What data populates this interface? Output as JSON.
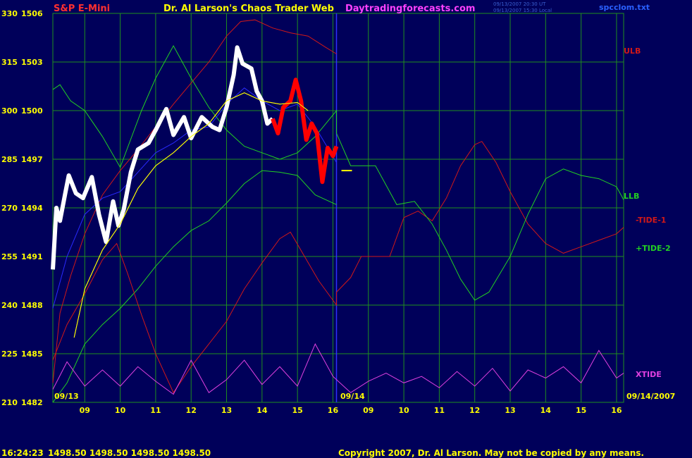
{
  "header": {
    "symbol": "S&P E-Mini",
    "title": "Dr. Al Larson's Chaos Trader Web",
    "site": "Daytradingforecasts.com",
    "timestamp1": "09/13/2007 20:30 UT",
    "timestamp2": "09/13/2007 15:30 Local",
    "file": "spcclom.txt"
  },
  "footer": {
    "time": "16:24:23",
    "quote": "1498.50 1498.50 1498.50 1498.50",
    "copyright": "Copyright 2007, Dr. Al Larson. May not be copied by any means."
  },
  "colors": {
    "background": "#00005a",
    "grid": "#1f8f1f",
    "tick_labels": "#ffff00",
    "price": "#ffffff",
    "price_recent": "#ff0000",
    "ulb": "#d01818",
    "llb": "#22d022",
    "tide1": "#d01818",
    "tide2": "#22d022",
    "xtide": "#e040e0",
    "average_fast": "#ffff00",
    "average_slow": "#2a2aff"
  },
  "chart_data": {
    "type": "line",
    "y_left_labels": [
      "330",
      "315",
      "300",
      "285",
      "270",
      "255",
      "240",
      "225",
      "210"
    ],
    "y_right_labels": [
      "1506",
      "1503",
      "1500",
      "1497",
      "1494",
      "1491",
      "1488",
      "1485",
      "1482"
    ],
    "price_range": [
      1482,
      1506
    ],
    "x_tick_labels": [
      "09",
      "10",
      "11",
      "12",
      "13",
      "14",
      "15",
      "16",
      "09",
      "10",
      "11",
      "12",
      "13",
      "14",
      "15",
      "16"
    ],
    "x_range_hours": [
      8.1,
      24.2
    ],
    "date_labels": [
      "09/13",
      "09/14",
      "09/14/2007"
    ],
    "now_hour": 16.1,
    "forecast_price": 1496.3,
    "series": [
      {
        "name": "ULB",
        "values": [
          [
            8.1,
            1483.2
          ],
          [
            8.3,
            1487.5
          ],
          [
            8.6,
            1489.8
          ],
          [
            9.0,
            1492.4
          ],
          [
            9.5,
            1494.8
          ],
          [
            10.0,
            1496.3
          ],
          [
            10.5,
            1497.6
          ],
          [
            11.0,
            1499.0
          ],
          [
            11.5,
            1500.4
          ],
          [
            12.0,
            1501.7
          ],
          [
            12.5,
            1503.0
          ],
          [
            13.0,
            1504.6
          ],
          [
            13.4,
            1505.5
          ],
          [
            13.8,
            1505.6
          ],
          [
            14.3,
            1505.1
          ],
          [
            14.8,
            1504.8
          ],
          [
            15.3,
            1504.6
          ],
          [
            15.8,
            1503.9
          ],
          [
            16.1,
            1503.5
          ]
        ]
      },
      {
        "name": "LLB",
        "values": [
          [
            8.1,
            1482.0
          ],
          [
            8.5,
            1483.2
          ],
          [
            9.0,
            1485.6
          ],
          [
            9.5,
            1486.8
          ],
          [
            10.0,
            1487.8
          ],
          [
            10.5,
            1489.0
          ],
          [
            11.0,
            1490.4
          ],
          [
            11.5,
            1491.6
          ],
          [
            12.0,
            1492.6
          ],
          [
            12.5,
            1493.2
          ],
          [
            13.0,
            1494.3
          ],
          [
            13.5,
            1495.5
          ],
          [
            14.0,
            1496.3
          ],
          [
            14.5,
            1496.2
          ],
          [
            15.0,
            1496.0
          ],
          [
            15.5,
            1494.8
          ],
          [
            16.1,
            1494.2
          ]
        ]
      },
      {
        "name": "-TIDE-1",
        "values": [
          [
            8.1,
            1484.6
          ],
          [
            8.5,
            1486.8
          ],
          [
            9.0,
            1488.7
          ],
          [
            9.5,
            1490.8
          ],
          [
            9.9,
            1491.8
          ],
          [
            10.2,
            1490.0
          ],
          [
            10.6,
            1487.4
          ],
          [
            11.0,
            1485.0
          ],
          [
            11.5,
            1482.6
          ],
          [
            12.0,
            1484.2
          ],
          [
            12.5,
            1485.6
          ],
          [
            13.0,
            1487.0
          ],
          [
            13.5,
            1489.0
          ],
          [
            14.0,
            1490.6
          ],
          [
            14.5,
            1492.1
          ],
          [
            14.8,
            1492.5
          ],
          [
            15.2,
            1491.0
          ],
          [
            15.6,
            1489.5
          ],
          [
            16.1,
            1488.0
          ],
          [
            16.1,
            1488.8
          ],
          [
            16.5,
            1489.7
          ],
          [
            16.8,
            1491.0
          ],
          [
            17.6,
            1491.0
          ],
          [
            18.0,
            1493.4
          ],
          [
            18.4,
            1493.8
          ],
          [
            18.8,
            1493.2
          ],
          [
            19.2,
            1494.6
          ],
          [
            19.6,
            1496.6
          ],
          [
            20.0,
            1497.9
          ],
          [
            20.2,
            1498.1
          ],
          [
            20.6,
            1496.8
          ],
          [
            21.0,
            1495.0
          ],
          [
            21.5,
            1493.0
          ],
          [
            22.0,
            1491.8
          ],
          [
            22.5,
            1491.2
          ],
          [
            23.0,
            1491.6
          ],
          [
            23.5,
            1492.0
          ],
          [
            24.0,
            1492.4
          ],
          [
            24.2,
            1492.8
          ]
        ]
      },
      {
        "name": "+TIDE-2",
        "values": [
          [
            8.1,
            1501.3
          ],
          [
            8.3,
            1501.6
          ],
          [
            8.6,
            1500.6
          ],
          [
            9.0,
            1500.0
          ],
          [
            9.5,
            1498.4
          ],
          [
            10.0,
            1496.5
          ],
          [
            10.6,
            1500.0
          ],
          [
            11.0,
            1502.0
          ],
          [
            11.5,
            1504.0
          ],
          [
            12.0,
            1502.0
          ],
          [
            12.5,
            1500.2
          ],
          [
            13.0,
            1498.8
          ],
          [
            13.5,
            1497.8
          ],
          [
            14.0,
            1497.4
          ],
          [
            14.5,
            1497.0
          ],
          [
            15.0,
            1497.4
          ],
          [
            15.5,
            1498.4
          ],
          [
            16.1,
            1500.0
          ],
          [
            16.1,
            1498.6
          ],
          [
            16.5,
            1496.6
          ],
          [
            17.2,
            1496.6
          ],
          [
            17.8,
            1494.2
          ],
          [
            18.3,
            1494.4
          ],
          [
            18.8,
            1493.0
          ],
          [
            19.2,
            1491.4
          ],
          [
            19.6,
            1489.6
          ],
          [
            20.0,
            1488.3
          ],
          [
            20.4,
            1488.8
          ],
          [
            21.0,
            1491.0
          ],
          [
            21.5,
            1493.6
          ],
          [
            22.0,
            1495.8
          ],
          [
            22.5,
            1496.4
          ],
          [
            23.0,
            1496.0
          ],
          [
            23.5,
            1495.8
          ],
          [
            24.0,
            1495.3
          ],
          [
            24.2,
            1494.5
          ]
        ]
      },
      {
        "name": "XTIDE",
        "values": [
          [
            8.1,
            1482.8
          ],
          [
            8.5,
            1484.5
          ],
          [
            9.0,
            1483.0
          ],
          [
            9.5,
            1484.0
          ],
          [
            10.0,
            1483.0
          ],
          [
            10.5,
            1484.2
          ],
          [
            11.0,
            1483.3
          ],
          [
            11.5,
            1482.5
          ],
          [
            12.0,
            1484.6
          ],
          [
            12.5,
            1482.6
          ],
          [
            13.0,
            1483.4
          ],
          [
            13.5,
            1484.6
          ],
          [
            14.0,
            1483.1
          ],
          [
            14.5,
            1484.2
          ],
          [
            15.0,
            1483.0
          ],
          [
            15.5,
            1485.6
          ],
          [
            16.0,
            1483.6
          ],
          [
            16.5,
            1482.6
          ],
          [
            17.0,
            1483.3
          ],
          [
            17.5,
            1483.8
          ],
          [
            18.0,
            1483.2
          ],
          [
            18.5,
            1483.6
          ],
          [
            19.0,
            1482.9
          ],
          [
            19.5,
            1483.9
          ],
          [
            20.0,
            1483.0
          ],
          [
            20.5,
            1484.1
          ],
          [
            21.0,
            1482.7
          ],
          [
            21.5,
            1484.0
          ],
          [
            22.0,
            1483.5
          ],
          [
            22.5,
            1484.2
          ],
          [
            23.0,
            1483.2
          ],
          [
            23.5,
            1485.2
          ],
          [
            24.0,
            1483.5
          ],
          [
            24.2,
            1483.8
          ]
        ]
      },
      {
        "name": "",
        "values": [
          [
            8.1,
            1487.8
          ],
          [
            8.5,
            1491.0
          ],
          [
            9.0,
            1493.6
          ],
          [
            9.5,
            1494.6
          ],
          [
            10.0,
            1495.0
          ],
          [
            10.5,
            1496.2
          ],
          [
            11.0,
            1497.4
          ],
          [
            11.5,
            1498.0
          ],
          [
            12.0,
            1498.8
          ],
          [
            12.5,
            1499.0
          ],
          [
            13.0,
            1500.4
          ],
          [
            13.5,
            1501.4
          ],
          [
            14.0,
            1500.6
          ],
          [
            14.5,
            1500.0
          ],
          [
            15.0,
            1500.4
          ],
          [
            15.5,
            1499.0
          ],
          [
            16.1,
            1496.8
          ]
        ]
      },
      {
        "name": "",
        "values": [
          [
            8.7,
            1486.0
          ],
          [
            9.0,
            1489.0
          ],
          [
            9.5,
            1491.4
          ],
          [
            10.0,
            1493.0
          ],
          [
            10.5,
            1495.2
          ],
          [
            11.0,
            1496.6
          ],
          [
            11.5,
            1497.4
          ],
          [
            12.0,
            1498.4
          ],
          [
            12.5,
            1499.2
          ],
          [
            13.0,
            1500.6
          ],
          [
            13.5,
            1501.1
          ],
          [
            14.0,
            1500.6
          ],
          [
            14.5,
            1500.4
          ],
          [
            15.0,
            1500.5
          ],
          [
            15.3,
            1500.0
          ]
        ]
      },
      {
        "name": "",
        "values": [
          [
            8.1,
            1490.2
          ],
          [
            8.2,
            1494.0
          ],
          [
            8.3,
            1493.2
          ],
          [
            8.45,
            1494.9
          ],
          [
            8.55,
            1496.0
          ],
          [
            8.75,
            1494.9
          ],
          [
            8.95,
            1494.6
          ],
          [
            9.2,
            1495.9
          ],
          [
            9.4,
            1493.6
          ],
          [
            9.6,
            1491.9
          ],
          [
            9.8,
            1494.4
          ],
          [
            9.95,
            1492.9
          ],
          [
            10.1,
            1493.9
          ],
          [
            10.3,
            1496.2
          ],
          [
            10.5,
            1497.6
          ],
          [
            10.8,
            1498.0
          ],
          [
            11.0,
            1498.8
          ],
          [
            11.3,
            1500.1
          ],
          [
            11.5,
            1498.5
          ],
          [
            11.8,
            1499.6
          ],
          [
            12.0,
            1498.3
          ],
          [
            12.3,
            1499.6
          ],
          [
            12.6,
            1499.0
          ],
          [
            12.8,
            1498.8
          ],
          [
            13.0,
            1500.2
          ],
          [
            13.2,
            1502.2
          ],
          [
            13.3,
            1503.9
          ],
          [
            13.45,
            1502.9
          ],
          [
            13.7,
            1502.6
          ],
          [
            13.85,
            1501.2
          ],
          [
            14.0,
            1500.6
          ],
          [
            14.15,
            1499.2
          ],
          [
            14.3,
            1499.5
          ],
          [
            14.45,
            1498.6
          ],
          [
            14.6,
            1500.2
          ],
          [
            14.8,
            1500.6
          ],
          [
            14.95,
            1501.9
          ],
          [
            15.1,
            1500.6
          ],
          [
            15.25,
            1498.2
          ],
          [
            15.4,
            1499.2
          ],
          [
            15.55,
            1498.6
          ],
          [
            15.7,
            1495.6
          ],
          [
            15.85,
            1497.7
          ],
          [
            16.0,
            1497.2
          ],
          [
            16.1,
            1497.8
          ]
        ]
      }
    ]
  }
}
